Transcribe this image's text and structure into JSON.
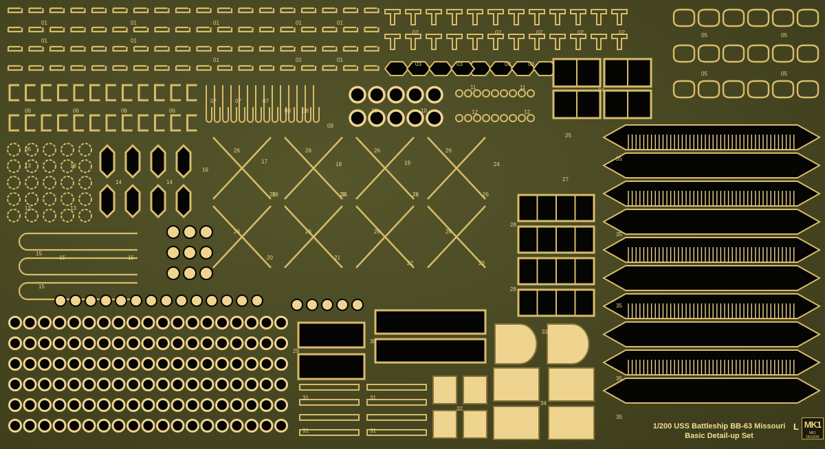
{
  "caption": {
    "line1": "1/200 USS Battleship BB-63 Missouri",
    "line2": "Basic Detail-up Set",
    "fret_letter": "L"
  },
  "logo": {
    "mark": "MK1",
    "sub": "MK1 DESIGN"
  },
  "colors": {
    "brass": "#d8bc6a",
    "brass_light": "#efd490",
    "fret_base": "#474722",
    "void": "#050503",
    "label": "#e6d28a"
  },
  "part_labels": [
    "01",
    "01",
    "01",
    "01",
    "01",
    "01",
    "01",
    "01",
    "01",
    "01",
    "02",
    "02",
    "02",
    "02",
    "02",
    "03",
    "03",
    "03",
    "03",
    "04",
    "05",
    "05",
    "05",
    "05",
    "06",
    "06",
    "06",
    "06",
    "06",
    "07",
    "07",
    "07",
    "08",
    "08",
    "09",
    "10",
    "10",
    "11",
    "11",
    "12",
    "12",
    "13",
    "13",
    "13",
    "13",
    "14",
    "14",
    "15",
    "15",
    "15",
    "15",
    "16",
    "17",
    "18",
    "19",
    "20",
    "21",
    "22",
    "23",
    "24",
    "25",
    "26",
    "26",
    "26",
    "26",
    "26",
    "26",
    "26",
    "26",
    "26",
    "26",
    "26",
    "26",
    "26",
    "26",
    "26",
    "27",
    "28",
    "28",
    "29",
    "30",
    "31",
    "31",
    "31",
    "31",
    "32",
    "33",
    "34",
    "35",
    "35",
    "35",
    "35",
    "35"
  ]
}
